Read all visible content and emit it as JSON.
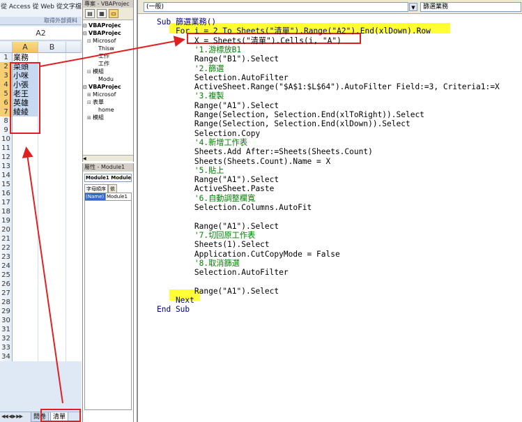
{
  "excel": {
    "ribbon_text": "從 Access 從 Web 從文字檔 從",
    "ribbon_group_label": "取得外部資料",
    "name_box": "A2",
    "columns": [
      "A",
      "B"
    ],
    "rows": [
      {
        "num": "1",
        "a": "業務"
      },
      {
        "num": "2",
        "a": "菜頭"
      },
      {
        "num": "3",
        "a": "小咪"
      },
      {
        "num": "4",
        "a": "小張"
      },
      {
        "num": "5",
        "a": "老王"
      },
      {
        "num": "6",
        "a": "英雄"
      },
      {
        "num": "7",
        "a": "綾綾"
      },
      {
        "num": "8",
        "a": ""
      },
      {
        "num": "9",
        "a": ""
      },
      {
        "num": "10",
        "a": ""
      },
      {
        "num": "11",
        "a": ""
      },
      {
        "num": "12",
        "a": ""
      },
      {
        "num": "13",
        "a": ""
      },
      {
        "num": "14",
        "a": ""
      },
      {
        "num": "15",
        "a": ""
      },
      {
        "num": "16",
        "a": ""
      },
      {
        "num": "17",
        "a": ""
      },
      {
        "num": "18",
        "a": ""
      },
      {
        "num": "19",
        "a": ""
      },
      {
        "num": "20",
        "a": ""
      },
      {
        "num": "21",
        "a": ""
      },
      {
        "num": "22",
        "a": ""
      },
      {
        "num": "23",
        "a": ""
      },
      {
        "num": "24",
        "a": ""
      },
      {
        "num": "25",
        "a": ""
      },
      {
        "num": "26",
        "a": ""
      },
      {
        "num": "27",
        "a": ""
      },
      {
        "num": "28",
        "a": ""
      },
      {
        "num": "29",
        "a": ""
      },
      {
        "num": "30",
        "a": ""
      },
      {
        "num": "31",
        "a": ""
      },
      {
        "num": "32",
        "a": ""
      },
      {
        "num": "33",
        "a": ""
      },
      {
        "num": "34",
        "a": ""
      }
    ],
    "sheet_tabs": [
      "問卷",
      "清單"
    ]
  },
  "project": {
    "title": "專案 - VBAProjec",
    "tree": [
      {
        "text": "VBAProjec",
        "bold": true,
        "glyph": "⊟"
      },
      {
        "text": "VBAProjec",
        "bold": true,
        "glyph": "⊟"
      },
      {
        "text": "Microsof",
        "bold": false,
        "glyph": "⊟"
      },
      {
        "text": "Thisw",
        "bold": false,
        "glyph": ""
      },
      {
        "text": "工作",
        "bold": false,
        "glyph": ""
      },
      {
        "text": "工作",
        "bold": false,
        "glyph": ""
      },
      {
        "text": "模組",
        "bold": false,
        "glyph": "⊟"
      },
      {
        "text": "Modu",
        "bold": false,
        "glyph": ""
      },
      {
        "text": "VBAProjec",
        "bold": true,
        "glyph": "⊟"
      },
      {
        "text": "Microsof",
        "bold": false,
        "glyph": "⊞"
      },
      {
        "text": "表單",
        "bold": false,
        "glyph": "⊟"
      },
      {
        "text": "home",
        "bold": false,
        "glyph": ""
      },
      {
        "text": "模組",
        "bold": false,
        "glyph": "⊞"
      }
    ]
  },
  "props": {
    "title": "屬性 - Module1",
    "select": "Module1 Module",
    "tabs": [
      "字母順序",
      "依"
    ],
    "prop_name": "(Name)",
    "prop_value": "Module1"
  },
  "code": {
    "object_combo": "(一般)",
    "proc_combo": "篩選業務",
    "lines": [
      {
        "text": "Sub 篩選業務()",
        "color": "kw"
      },
      {
        "text": "    For i = 2 To Sheets(\"清單\").Range(\"A2\").End(xlDown).Row",
        "color": "kw"
      },
      {
        "text": "        X = Sheets(\"清單\").Cells(i, \"A\")",
        "color": ""
      },
      {
        "text": "        '1.游標放B1",
        "color": "cm"
      },
      {
        "text": "        Range(\"B1\").Select",
        "color": ""
      },
      {
        "text": "        '2.篩選",
        "color": "cm"
      },
      {
        "text": "        Selection.AutoFilter",
        "color": ""
      },
      {
        "text": "        ActiveSheet.Range(\"$A$1:$L$64\").AutoFilter Field:=3, Criteria1:=X",
        "color": ""
      },
      {
        "text": "        '3.複製",
        "color": "cm"
      },
      {
        "text": "        Range(\"A1\").Select",
        "color": ""
      },
      {
        "text": "        Range(Selection, Selection.End(xlToRight)).Select",
        "color": ""
      },
      {
        "text": "        Range(Selection, Selection.End(xlDown)).Select",
        "color": ""
      },
      {
        "text": "        Selection.Copy",
        "color": ""
      },
      {
        "text": "        '4.新增工作表",
        "color": "cm"
      },
      {
        "text": "        Sheets.Add After:=Sheets(Sheets.Count)",
        "color": ""
      },
      {
        "text": "        Sheets(Sheets.Count).Name = X",
        "color": ""
      },
      {
        "text": "        '5.貼上",
        "color": "cm"
      },
      {
        "text": "        Range(\"A1\").Select",
        "color": ""
      },
      {
        "text": "        ActiveSheet.Paste",
        "color": ""
      },
      {
        "text": "        '6.自動調整欄寬",
        "color": "cm"
      },
      {
        "text": "        Selection.Columns.AutoFit",
        "color": ""
      },
      {
        "text": "",
        "color": ""
      },
      {
        "text": "        Range(\"A1\").Select",
        "color": ""
      },
      {
        "text": "        '7.切回原工作表",
        "color": "cm"
      },
      {
        "text": "        Sheets(1).Select",
        "color": ""
      },
      {
        "text": "        Application.CutCopyMode = False",
        "color": ""
      },
      {
        "text": "        '8.取消篩選",
        "color": "cm"
      },
      {
        "text": "        Selection.AutoFilter",
        "color": ""
      },
      {
        "text": "",
        "color": ""
      },
      {
        "text": "        Range(\"A1\").Select",
        "color": ""
      },
      {
        "text": "    Next",
        "color": "kw"
      },
      {
        "text": "End Sub",
        "color": "kw"
      }
    ]
  },
  "colors": {
    "highlight": "#ffff33",
    "annotation": "#e02020",
    "keyword": "#00007f",
    "comment": "#007f00"
  }
}
